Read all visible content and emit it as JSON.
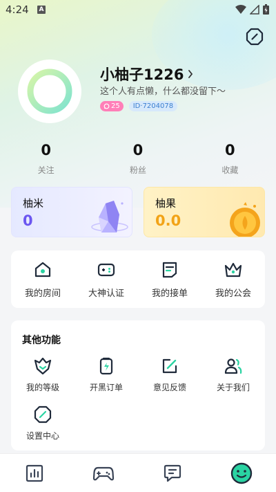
{
  "status_bar": {
    "time": "4:24",
    "indicator": "A"
  },
  "profile": {
    "nickname": "小柚子1226",
    "bio": "这个人有点懒，什么都没留下～",
    "count_badge": "25",
    "id_badge": "ID·7204078"
  },
  "stats": [
    {
      "value": "0",
      "label": "关注"
    },
    {
      "value": "0",
      "label": "粉丝"
    },
    {
      "value": "0",
      "label": "收藏"
    }
  ],
  "wallet": {
    "yumi": {
      "title": "柚米",
      "value": "0"
    },
    "yuguo": {
      "title": "柚果",
      "value": "0.0"
    }
  },
  "actions": [
    {
      "label": "我的房间",
      "icon": "house-icon"
    },
    {
      "label": "大神认证",
      "icon": "gamepad-icon"
    },
    {
      "label": "我的接单",
      "icon": "order-note-icon"
    },
    {
      "label": "我的公会",
      "icon": "crown-icon"
    }
  ],
  "more": {
    "title": "其他功能",
    "items": [
      {
        "label": "我的等级",
        "icon": "level-badge-icon"
      },
      {
        "label": "开黑订单",
        "icon": "clipboard-bolt-icon"
      },
      {
        "label": "意见反馈",
        "icon": "edit-icon"
      },
      {
        "label": "关于我们",
        "icon": "people-icon"
      },
      {
        "label": "设置中心",
        "icon": "settings-icon"
      }
    ]
  },
  "colors": {
    "accent": "#2ad3a2",
    "icon_dark": "#1f2a3a",
    "yumi": "#6b56f0",
    "yuguo": "#f2a317"
  }
}
